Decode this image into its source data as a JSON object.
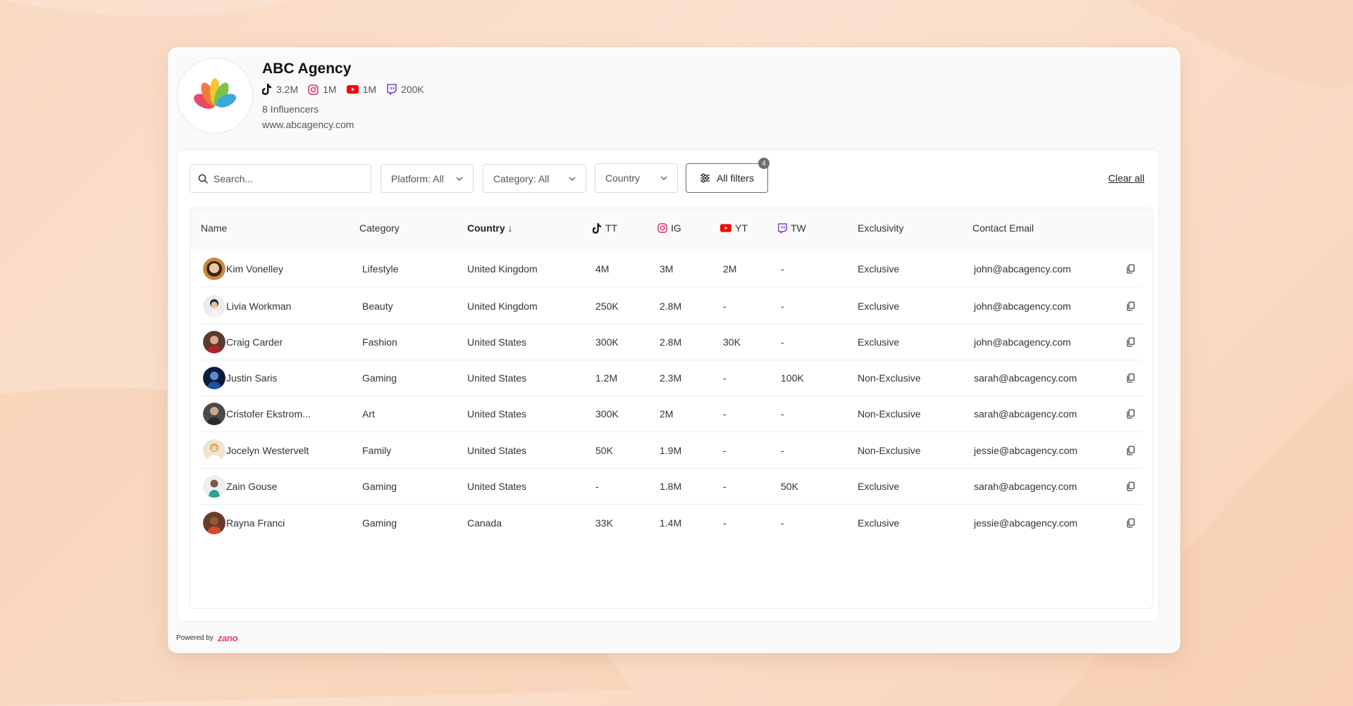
{
  "agency": {
    "name": "ABC Agency",
    "stats": {
      "tiktok": "3.2M",
      "instagram": "1M",
      "youtube": "1M",
      "twitch": "200K"
    },
    "influencers": "8 Influencers",
    "website": "www.abcagency.com"
  },
  "filters": {
    "search_placeholder": "Search...",
    "platform": "Platform: All",
    "category": "Category: All",
    "country": "Country",
    "all_filters": "All filters",
    "badge_count": "4",
    "clear_all": "Clear all"
  },
  "table": {
    "headers": {
      "name": "Name",
      "category": "Category",
      "country": "Country ↓",
      "tt": "TT",
      "ig": "IG",
      "yt": "YT",
      "tw": "TW",
      "exclusivity": "Exclusivity",
      "email": "Contact Email"
    },
    "rows": [
      {
        "name": "Kim Vonelley",
        "category": "Lifestyle",
        "country": "United Kingdom",
        "tt": "4M",
        "ig": "3M",
        "yt": "2M",
        "tw": "-",
        "exclusivity": "Exclusive",
        "email": "john@abcagency.com"
      },
      {
        "name": "Livia Workman",
        "category": "Beauty",
        "country": "United Kingdom",
        "tt": "250K",
        "ig": "2.8M",
        "yt": "-",
        "tw": "-",
        "exclusivity": "Exclusive",
        "email": "john@abcagency.com"
      },
      {
        "name": "Craig Carder",
        "category": "Fashion",
        "country": "United States",
        "tt": "300K",
        "ig": "2.8M",
        "yt": "30K",
        "tw": "-",
        "exclusivity": "Exclusive",
        "email": "john@abcagency.com"
      },
      {
        "name": "Justin Saris",
        "category": "Gaming",
        "country": "United States",
        "tt": "1.2M",
        "ig": "2.3M",
        "yt": "-",
        "tw": "100K",
        "exclusivity": "Non-Exclusive",
        "email": "sarah@abcagency.com"
      },
      {
        "name": "Cristofer Ekstrom...",
        "category": "Art",
        "country": "United States",
        "tt": "300K",
        "ig": "2M",
        "yt": "-",
        "tw": "-",
        "exclusivity": "Non-Exclusive",
        "email": "sarah@abcagency.com"
      },
      {
        "name": "Jocelyn Westervelt",
        "category": "Family",
        "country": "United States",
        "tt": "50K",
        "ig": "1.9M",
        "yt": "-",
        "tw": "-",
        "exclusivity": "Non-Exclusive",
        "email": "jessie@abcagency.com"
      },
      {
        "name": "Zain Gouse",
        "category": "Gaming",
        "country": "United States",
        "tt": "-",
        "ig": "1.8M",
        "yt": "-",
        "tw": "50K",
        "exclusivity": "Exclusive",
        "email": "sarah@abcagency.com"
      },
      {
        "name": "Rayna Franci",
        "category": "Gaming",
        "country": "Canada",
        "tt": "33K",
        "ig": "1.4M",
        "yt": "-",
        "tw": "-",
        "exclusivity": "Exclusive",
        "email": "jessie@abcagency.com"
      }
    ]
  },
  "footer": {
    "powered_by": "Powered by",
    "brand": "zano"
  },
  "colors": {
    "tiktok": "#111111",
    "instagram": "#e1306c",
    "youtube": "#ff0000",
    "twitch": "#7b45c7",
    "brand": "#ec3d6a"
  }
}
